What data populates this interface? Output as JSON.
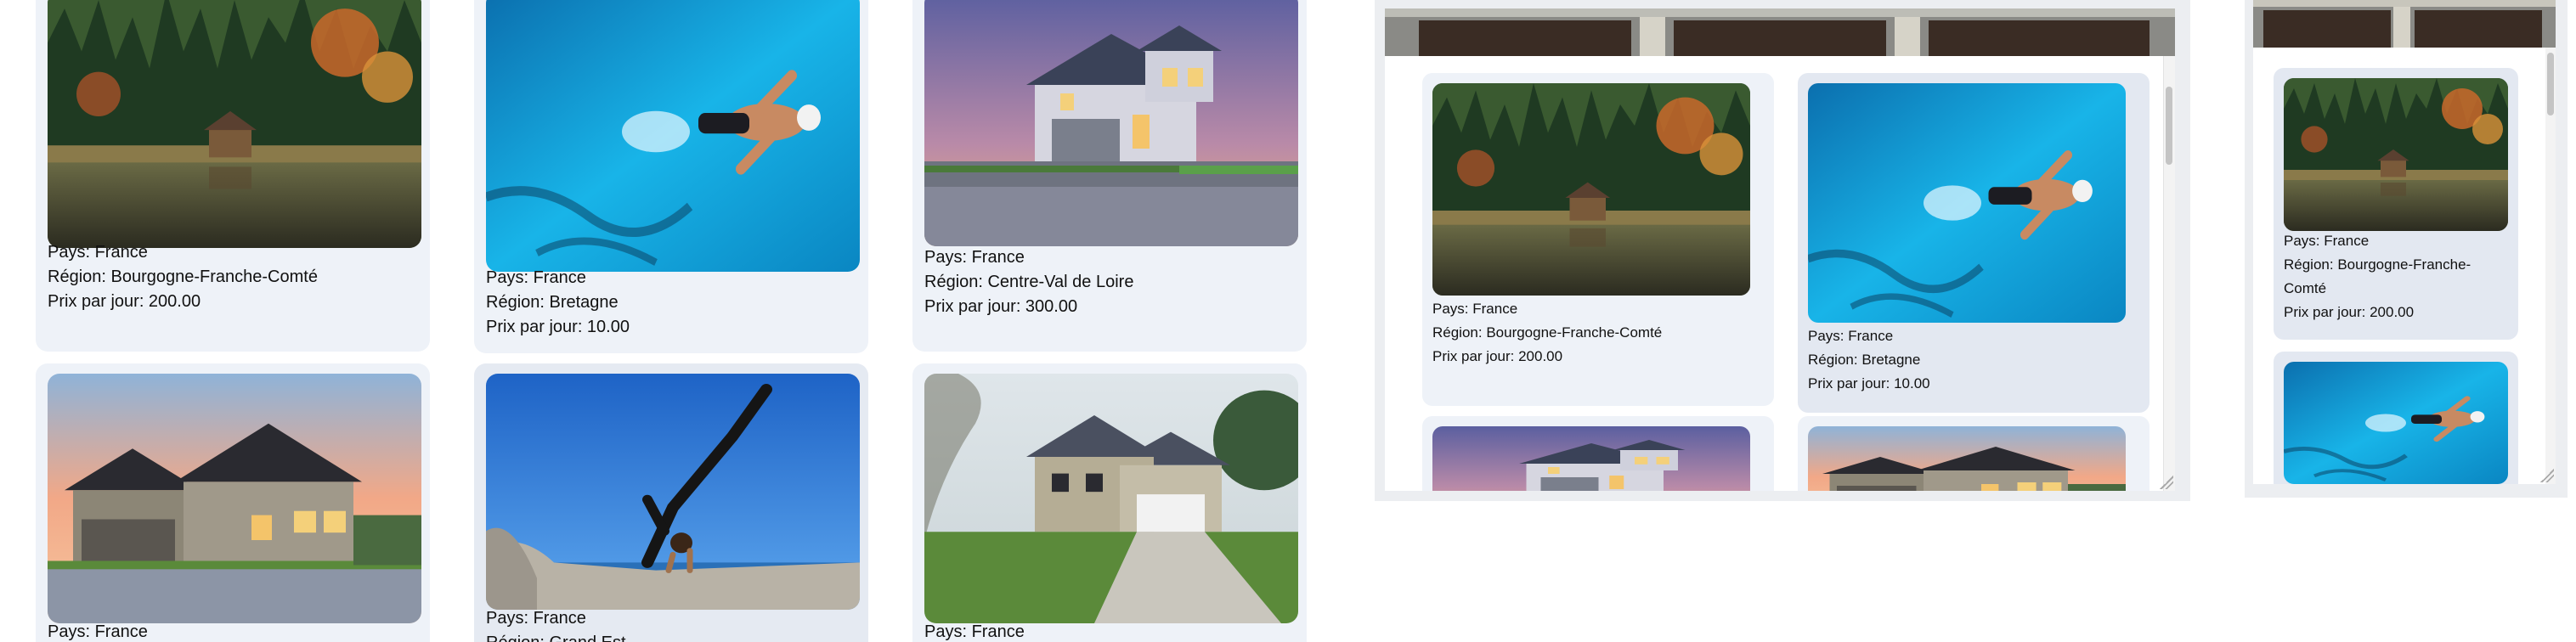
{
  "listings": [
    {
      "pays_label": "Pays: France",
      "region_label": "Région: Bourgogne-Franche-Comté",
      "prix_label": "Prix par jour: 200.00",
      "image": "forest-lake-cabin"
    },
    {
      "pays_label": "Pays: France",
      "region_label": "Région: Bretagne",
      "prix_label": "Prix par jour: 10.00",
      "image": "swimmer-pool"
    },
    {
      "pays_label": "Pays: France",
      "region_label": "Région: Centre-Val de Loire",
      "prix_label": "Prix par jour: 300.00",
      "image": "house-dusk"
    },
    {
      "pays_label": "Pays: France",
      "region_label": "",
      "prix_label": "",
      "image": "house-sunset"
    },
    {
      "pays_label": "Pays: France",
      "region_label": "Région: Grand Est",
      "prix_label": "",
      "image": "yoga-pose"
    },
    {
      "pays_label": "Pays: France",
      "region_label": "",
      "prix_label": "",
      "image": "suburban-house"
    }
  ],
  "right_panel": {
    "card1": {
      "pays_label": "Pays: France",
      "region_line1": "Région: Bourgogne-Franche-",
      "region_line2": "Comté",
      "prix_label": "Prix par jour: 200.00"
    }
  },
  "colors": {
    "card_bg": "#eef2f8",
    "card_bg_alt": "#e3e8f1",
    "frame_bg": "#eceef1"
  }
}
